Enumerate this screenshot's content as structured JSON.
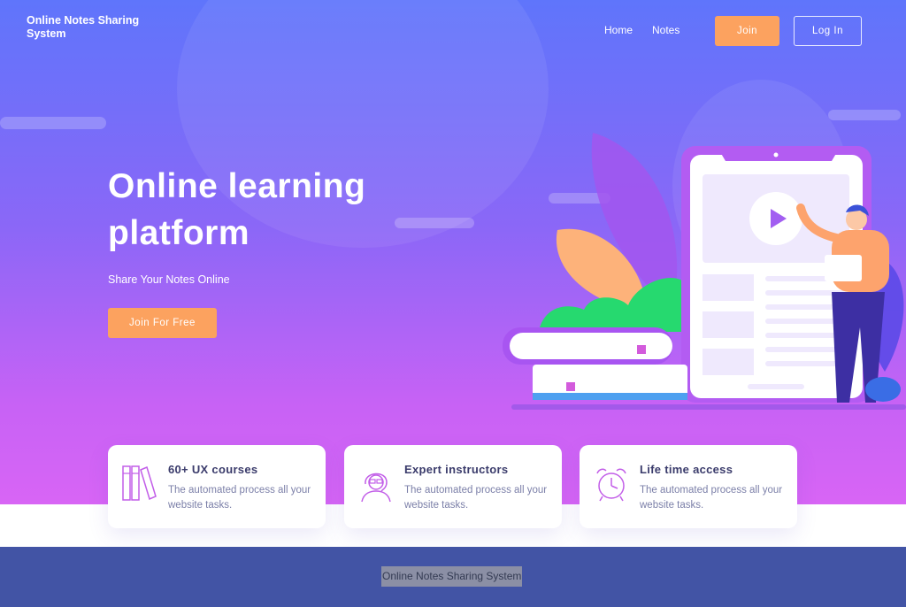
{
  "header": {
    "brand": "Online Notes Sharing System",
    "nav": [
      {
        "label": "Home"
      },
      {
        "label": "Notes"
      }
    ],
    "join_label": "Join",
    "login_label": "Log In"
  },
  "hero": {
    "title": "Online learning platform",
    "subtitle": "Share Your Notes Online",
    "cta_label": "Join For Free"
  },
  "features": [
    {
      "icon": "books-icon",
      "title": "60+ UX courses",
      "description": "The automated process all your website tasks."
    },
    {
      "icon": "instructor-icon",
      "title": "Expert instructors",
      "description": "The automated process all your website tasks."
    },
    {
      "icon": "alarm-clock-icon",
      "title": "Life time access",
      "description": "The automated process all your website tasks."
    }
  ],
  "footer": {
    "text": "Online Notes Sharing System"
  },
  "colors": {
    "gradient_top": "#5f75fb",
    "gradient_bottom": "#d865f5",
    "accent_orange": "#fca25f",
    "footer_bg": "#4254a5",
    "card_title": "#3a3b6b"
  }
}
